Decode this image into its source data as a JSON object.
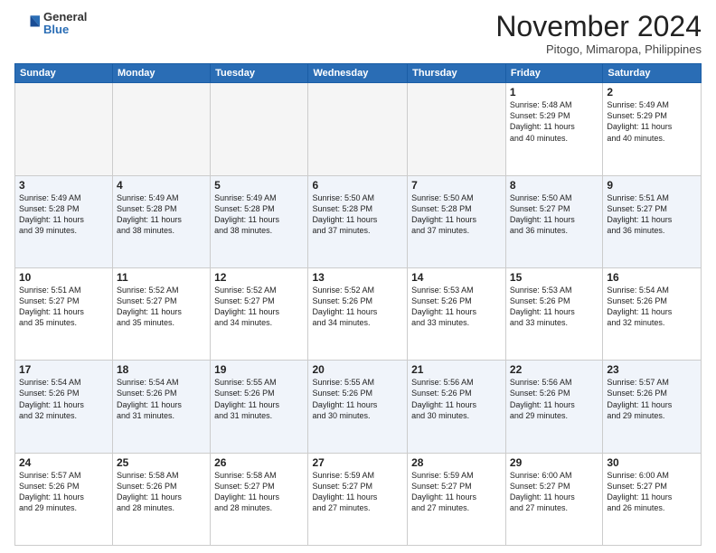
{
  "logo": {
    "general": "General",
    "blue": "Blue"
  },
  "title": "November 2024",
  "location": "Pitogo, Mimaropa, Philippines",
  "weekdays": [
    "Sunday",
    "Monday",
    "Tuesday",
    "Wednesday",
    "Thursday",
    "Friday",
    "Saturday"
  ],
  "weeks": [
    [
      {
        "day": "",
        "info": ""
      },
      {
        "day": "",
        "info": ""
      },
      {
        "day": "",
        "info": ""
      },
      {
        "day": "",
        "info": ""
      },
      {
        "day": "",
        "info": ""
      },
      {
        "day": "1",
        "info": "Sunrise: 5:48 AM\nSunset: 5:29 PM\nDaylight: 11 hours\nand 40 minutes."
      },
      {
        "day": "2",
        "info": "Sunrise: 5:49 AM\nSunset: 5:29 PM\nDaylight: 11 hours\nand 40 minutes."
      }
    ],
    [
      {
        "day": "3",
        "info": "Sunrise: 5:49 AM\nSunset: 5:28 PM\nDaylight: 11 hours\nand 39 minutes."
      },
      {
        "day": "4",
        "info": "Sunrise: 5:49 AM\nSunset: 5:28 PM\nDaylight: 11 hours\nand 38 minutes."
      },
      {
        "day": "5",
        "info": "Sunrise: 5:49 AM\nSunset: 5:28 PM\nDaylight: 11 hours\nand 38 minutes."
      },
      {
        "day": "6",
        "info": "Sunrise: 5:50 AM\nSunset: 5:28 PM\nDaylight: 11 hours\nand 37 minutes."
      },
      {
        "day": "7",
        "info": "Sunrise: 5:50 AM\nSunset: 5:28 PM\nDaylight: 11 hours\nand 37 minutes."
      },
      {
        "day": "8",
        "info": "Sunrise: 5:50 AM\nSunset: 5:27 PM\nDaylight: 11 hours\nand 36 minutes."
      },
      {
        "day": "9",
        "info": "Sunrise: 5:51 AM\nSunset: 5:27 PM\nDaylight: 11 hours\nand 36 minutes."
      }
    ],
    [
      {
        "day": "10",
        "info": "Sunrise: 5:51 AM\nSunset: 5:27 PM\nDaylight: 11 hours\nand 35 minutes."
      },
      {
        "day": "11",
        "info": "Sunrise: 5:52 AM\nSunset: 5:27 PM\nDaylight: 11 hours\nand 35 minutes."
      },
      {
        "day": "12",
        "info": "Sunrise: 5:52 AM\nSunset: 5:27 PM\nDaylight: 11 hours\nand 34 minutes."
      },
      {
        "day": "13",
        "info": "Sunrise: 5:52 AM\nSunset: 5:26 PM\nDaylight: 11 hours\nand 34 minutes."
      },
      {
        "day": "14",
        "info": "Sunrise: 5:53 AM\nSunset: 5:26 PM\nDaylight: 11 hours\nand 33 minutes."
      },
      {
        "day": "15",
        "info": "Sunrise: 5:53 AM\nSunset: 5:26 PM\nDaylight: 11 hours\nand 33 minutes."
      },
      {
        "day": "16",
        "info": "Sunrise: 5:54 AM\nSunset: 5:26 PM\nDaylight: 11 hours\nand 32 minutes."
      }
    ],
    [
      {
        "day": "17",
        "info": "Sunrise: 5:54 AM\nSunset: 5:26 PM\nDaylight: 11 hours\nand 32 minutes."
      },
      {
        "day": "18",
        "info": "Sunrise: 5:54 AM\nSunset: 5:26 PM\nDaylight: 11 hours\nand 31 minutes."
      },
      {
        "day": "19",
        "info": "Sunrise: 5:55 AM\nSunset: 5:26 PM\nDaylight: 11 hours\nand 31 minutes."
      },
      {
        "day": "20",
        "info": "Sunrise: 5:55 AM\nSunset: 5:26 PM\nDaylight: 11 hours\nand 30 minutes."
      },
      {
        "day": "21",
        "info": "Sunrise: 5:56 AM\nSunset: 5:26 PM\nDaylight: 11 hours\nand 30 minutes."
      },
      {
        "day": "22",
        "info": "Sunrise: 5:56 AM\nSunset: 5:26 PM\nDaylight: 11 hours\nand 29 minutes."
      },
      {
        "day": "23",
        "info": "Sunrise: 5:57 AM\nSunset: 5:26 PM\nDaylight: 11 hours\nand 29 minutes."
      }
    ],
    [
      {
        "day": "24",
        "info": "Sunrise: 5:57 AM\nSunset: 5:26 PM\nDaylight: 11 hours\nand 29 minutes."
      },
      {
        "day": "25",
        "info": "Sunrise: 5:58 AM\nSunset: 5:26 PM\nDaylight: 11 hours\nand 28 minutes."
      },
      {
        "day": "26",
        "info": "Sunrise: 5:58 AM\nSunset: 5:27 PM\nDaylight: 11 hours\nand 28 minutes."
      },
      {
        "day": "27",
        "info": "Sunrise: 5:59 AM\nSunset: 5:27 PM\nDaylight: 11 hours\nand 27 minutes."
      },
      {
        "day": "28",
        "info": "Sunrise: 5:59 AM\nSunset: 5:27 PM\nDaylight: 11 hours\nand 27 minutes."
      },
      {
        "day": "29",
        "info": "Sunrise: 6:00 AM\nSunset: 5:27 PM\nDaylight: 11 hours\nand 27 minutes."
      },
      {
        "day": "30",
        "info": "Sunrise: 6:00 AM\nSunset: 5:27 PM\nDaylight: 11 hours\nand 26 minutes."
      }
    ]
  ]
}
